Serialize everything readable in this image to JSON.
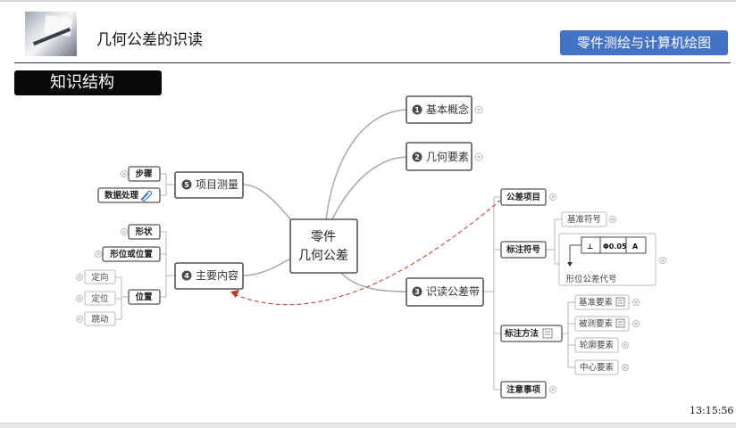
{
  "header": {
    "title": "几何公差的识读",
    "course": "零件测绘与计算机绘图",
    "section": "知识结构"
  },
  "mindmap": {
    "center": {
      "line1": "零件",
      "line2": "几何公差"
    },
    "right": [
      {
        "num": "1",
        "label": "基本概念"
      },
      {
        "num": "2",
        "label": "几何要素"
      },
      {
        "num": "3",
        "label": "识读公差带",
        "children": {
          "tolerance_item": "公差项目",
          "mark_symbol": "标注符号",
          "datum_symbol": "基准符号",
          "frame_note": "形位公差代号",
          "mark_method": "标注方法",
          "datum_element": "基准要素",
          "measured_element": "被测要素",
          "contour_element": "轮廓要素",
          "center_element": "中心要素",
          "notes": "注意事项"
        }
      }
    ],
    "left": [
      {
        "num": "5",
        "label": "项目测量",
        "children": {
          "steps": "步骤",
          "data_processing": "数据处理"
        }
      },
      {
        "num": "4",
        "label": "主要内容",
        "children": {
          "shape": "形状",
          "form_position": "形位或位置",
          "position": "位置",
          "orientation": "定向",
          "location": "定位",
          "runout": "跳动"
        }
      }
    ],
    "tolerance_frame": {
      "symbol": "⊥",
      "value": "Φ0.05",
      "datum": "A"
    }
  },
  "clock": "13:15:56"
}
